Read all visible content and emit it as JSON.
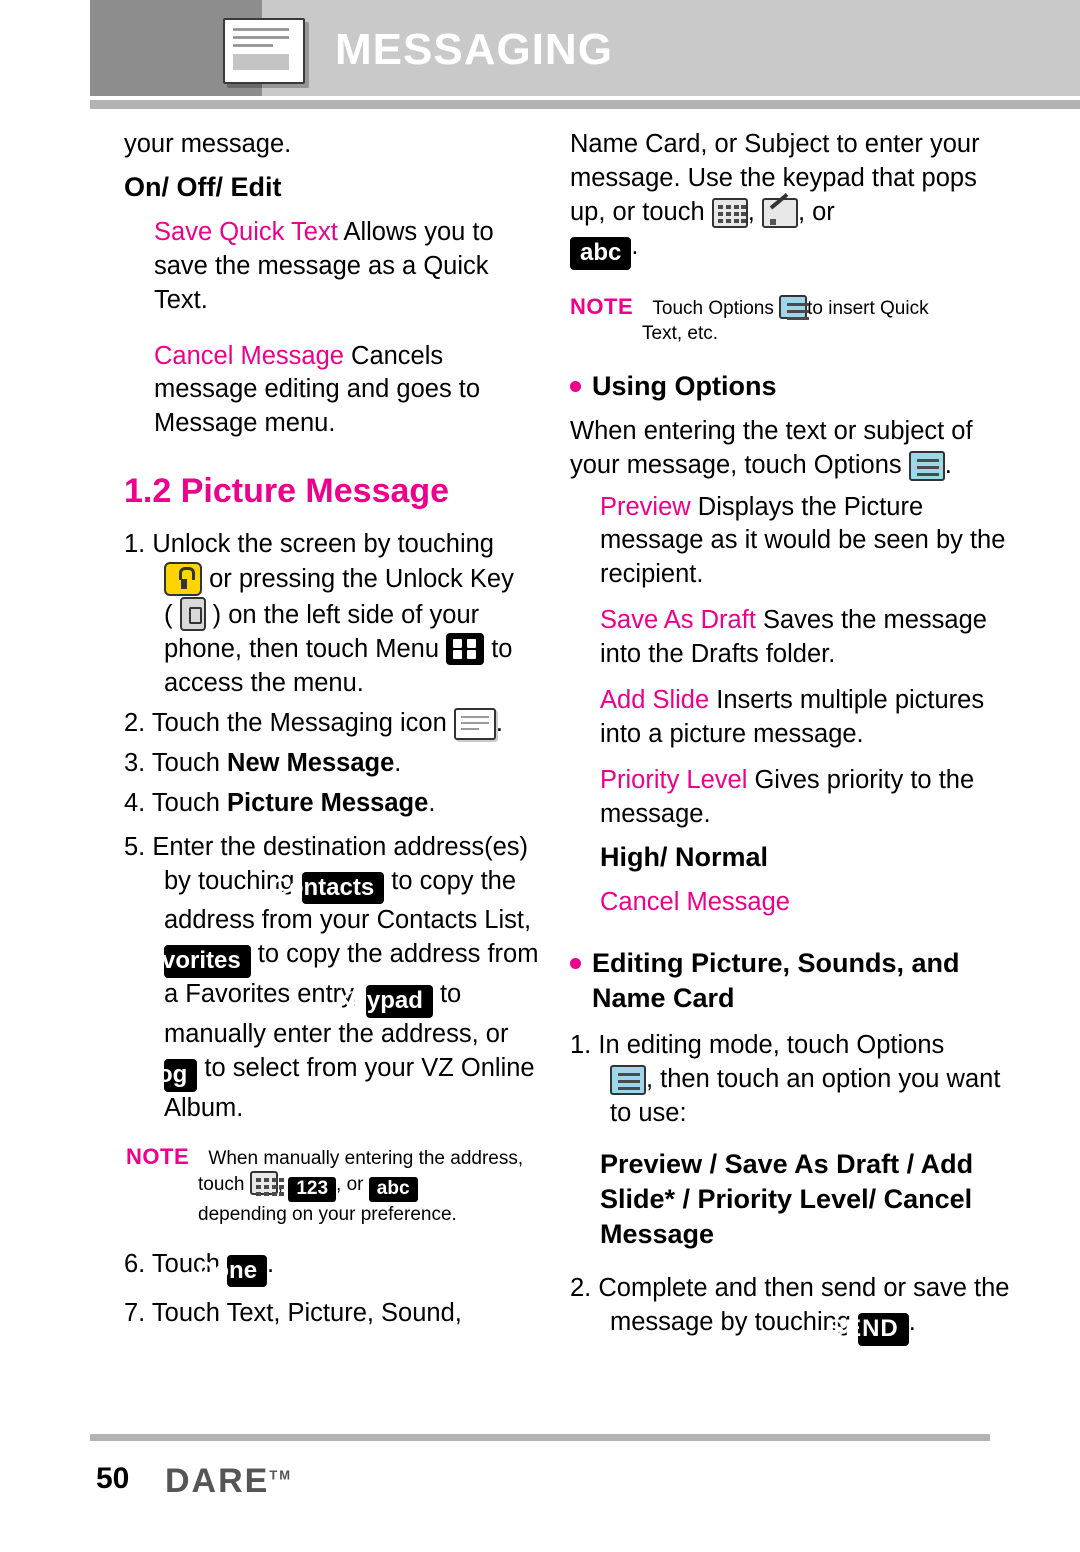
{
  "header": {
    "title": "MESSAGING",
    "icon": "messaging-envelope-icon"
  },
  "left_column": {
    "p1": "your message.",
    "h_onoffedit": "On/ Off/ Edit",
    "save_quick_text_term": "Save Quick Text",
    "save_quick_text_desc": " Allows you to save the message as a Quick Text.",
    "cancel_message_term": "Cancel Message",
    "cancel_message_desc": " Cancels message editing and goes to Message menu.",
    "section_title": "1.2 Picture Message",
    "step1_num": "1.",
    "step1_a": "Unlock the screen by touching",
    "step1_b": " or pressing the Unlock Key",
    "step1_c": "( ",
    "step1_d": " ) on the left side of your phone, then touch Menu",
    "step1_e": " to access the menu.",
    "step2_num": "2.",
    "step2_a": "Touch the Messaging icon",
    "step2_b": ".",
    "step3_num": "3.",
    "step3_a": "Touch ",
    "step3_b": "New Message",
    "step3_c": ".",
    "step4_num": "4.",
    "step4_a": "Touch ",
    "step4_b": "Picture Message",
    "step4_c": ".",
    "step5_num": "5.",
    "step5_a": "Enter the destination address(es) by touching ",
    "step5_key_contacts": "Contacts",
    "step5_b": " to copy the address from your Contacts List, ",
    "step5_key_favorites": "Favorites",
    "step5_c": " to copy the address from a Favorites entry, ",
    "step5_key_keypad": "Keypad",
    "step5_d": " to manually enter the address, or ",
    "step5_key_blog": "Blog",
    "step5_e": " to select from your VZ Online Album.",
    "note_label": "NOTE",
    "note_line1": "When manually entering the address,",
    "note_touch": "touch",
    "note_comma": ",",
    "note_key_123": "123",
    "note_or": ", or",
    "note_key_abc": "abc",
    "note_line3": "depending on your preference.",
    "step6_num": "6.",
    "step6_a": "Touch ",
    "step6_key_done": "Done",
    "step6_b": ".",
    "step7_num": "7.",
    "step7_a": "Touch Text, Picture, Sound,"
  },
  "right_column": {
    "p1_a": "Name Card, or Subject to enter your message. Use the keypad that pops up, or touch ",
    "p1_b": ", ",
    "p1_c": ", or",
    "key_abc": "abc",
    "p1_d": ".",
    "note_label": "NOTE",
    "note_a": "Touch Options",
    "note_b": "to insert Quick",
    "note_c": "Text, etc.",
    "head_using_options": "Using Options",
    "uo_a": "When entering the text or subject of your message, touch Options",
    "uo_b": ".",
    "preview_term": "Preview",
    "preview_desc": " Displays the Picture message as it would be seen by the recipient.",
    "save_draft_term": "Save As Draft",
    "save_draft_desc": " Saves the message into the Drafts folder.",
    "add_slide_term": "Add Slide",
    "add_slide_desc": " Inserts multiple pictures into a picture message.",
    "priority_term": "Priority Level",
    "priority_desc": " Gives priority to the message.",
    "high_normal": "High/ Normal",
    "cancel_message": "Cancel Message",
    "head_editing": "Editing Picture, Sounds, and Name Card",
    "e_step1_num": "1.",
    "e_step1_a": "In editing mode, touch Options",
    "e_step1_b": ", then touch an option you want to use:",
    "options_list": "Preview / Save As Draft / Add Slide* / Priority Level/ Cancel Message",
    "e_step2_num": "2.",
    "e_step2_a": "Complete and then send or save the message by touching ",
    "key_send": "SEND",
    "e_step2_b": "."
  },
  "footer": {
    "page_number": "50",
    "brand": "DARE",
    "brand_tm": "TM"
  },
  "colors": {
    "accent": "#ec008c",
    "header_bg": "#c9c9c9",
    "header_icon_bg": "#8d8d8d",
    "rule": "#b3b3b3"
  }
}
